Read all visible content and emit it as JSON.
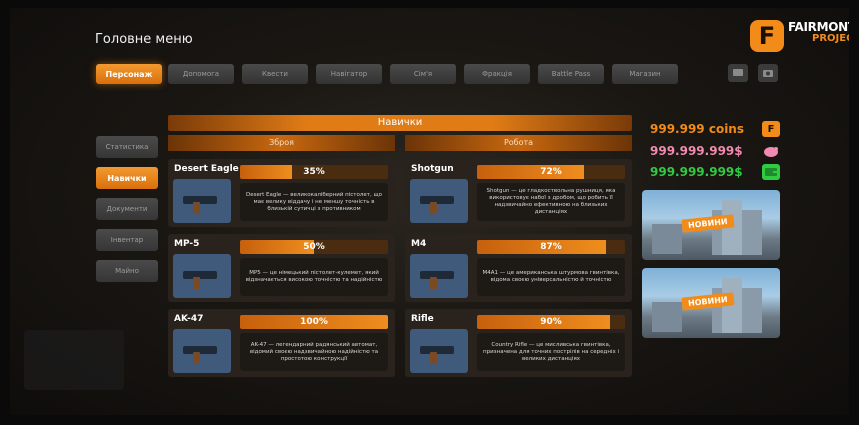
{
  "header": {
    "title": "Головне меню",
    "brand": {
      "letter": "F",
      "line1": "FAIRMONT",
      "line2": "PROJECT"
    }
  },
  "tabs": [
    "Персонаж",
    "Допомога",
    "Квести",
    "Навігатор",
    "Сім'я",
    "Фракція",
    "Battle Pass",
    "Магазин"
  ],
  "sidebar": [
    "Статистика",
    "Навички",
    "Документи",
    "Інвентар",
    "Майно"
  ],
  "skills": {
    "title": "Навички",
    "col_left": "Зброя",
    "col_right": "Робота",
    "cards": [
      {
        "name": "Desert Eagle",
        "percent": "35%",
        "progress": 35,
        "desc": "Desert Eagle — великокаліберний пістолет, що має велику віддачу і не меншу точність в близькій сутичці з противником"
      },
      {
        "name": "Shotgun",
        "percent": "72%",
        "progress": 72,
        "desc": "Shotgun — це гладкоствольна рушниця, яка використовує набої з дробом, що робить її надзвичайно ефективною на близьких дистанціях"
      },
      {
        "name": "MP-5",
        "percent": "50%",
        "progress": 50,
        "desc": "MP5 — це німецький пістолет-кулемет, який відзначається високою точністю та надійністю"
      },
      {
        "name": "M4",
        "percent": "87%",
        "progress": 87,
        "desc": "M4A1 — це американська штурмова гвинтівка, відома своєю універсальністю й точністю"
      },
      {
        "name": "AK-47",
        "percent": "100%",
        "progress": 100,
        "desc": "AK-47 — легендарний радянський автомат, відомий своєю надзвичайною надійністю та простотою конструкції"
      },
      {
        "name": "Rifle",
        "percent": "90%",
        "progress": 90,
        "desc": "Country Rifle — це мисливська гвинтівка, призначена для точних пострілів на середніх і великих дистанціях"
      }
    ]
  },
  "wallet": {
    "coins": "999.999 coins",
    "bank": "999.999.999$",
    "cash": "999.999.999$",
    "colors": {
      "coins": "#f28b18",
      "bank": "#f08ab0",
      "cash": "#2ecc40"
    }
  },
  "news": [
    {
      "badge": "НОВИНИ"
    },
    {
      "badge": "НОВИНИ"
    }
  ]
}
